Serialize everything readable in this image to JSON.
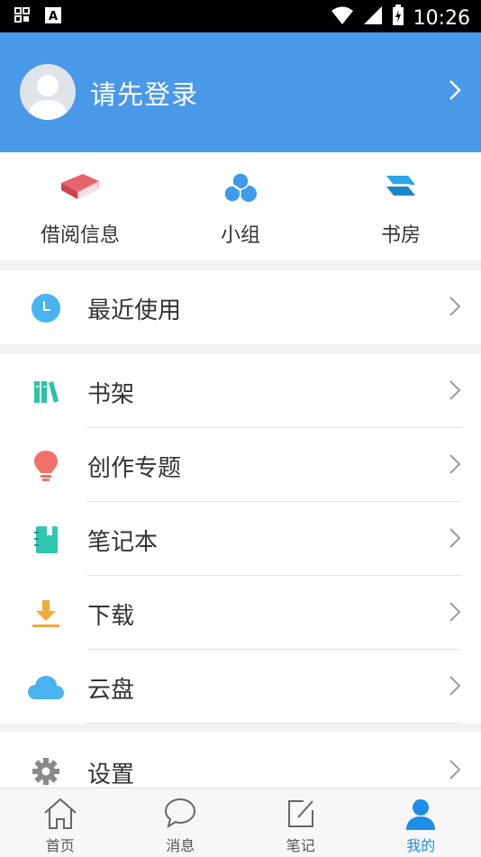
{
  "status_bar": {
    "time": "10:26"
  },
  "header": {
    "login_text": "请先登录"
  },
  "quick_actions": [
    {
      "label": "借阅信息",
      "icon": "book-icon"
    },
    {
      "label": "小组",
      "icon": "group-icon"
    },
    {
      "label": "书房",
      "icon": "study-icon"
    }
  ],
  "menu": {
    "recent": {
      "label": "最近使用",
      "icon": "clock-icon"
    },
    "items": [
      {
        "label": "书架",
        "icon": "bookshelf-icon"
      },
      {
        "label": "创作专题",
        "icon": "lightbulb-icon"
      },
      {
        "label": "笔记本",
        "icon": "notebook-icon"
      },
      {
        "label": "下载",
        "icon": "download-icon"
      },
      {
        "label": "云盘",
        "icon": "cloud-icon"
      }
    ],
    "settings": {
      "label": "设置",
      "icon": "gear-icon"
    }
  },
  "tabbar": {
    "tabs": [
      {
        "label": "首页",
        "icon": "home-icon"
      },
      {
        "label": "消息",
        "icon": "message-icon"
      },
      {
        "label": "笔记",
        "icon": "edit-icon"
      },
      {
        "label": "我的",
        "icon": "profile-icon"
      }
    ],
    "active_index": 3,
    "active_color": "#1e8ee6"
  },
  "colors": {
    "header_bg": "#4a98e8"
  }
}
